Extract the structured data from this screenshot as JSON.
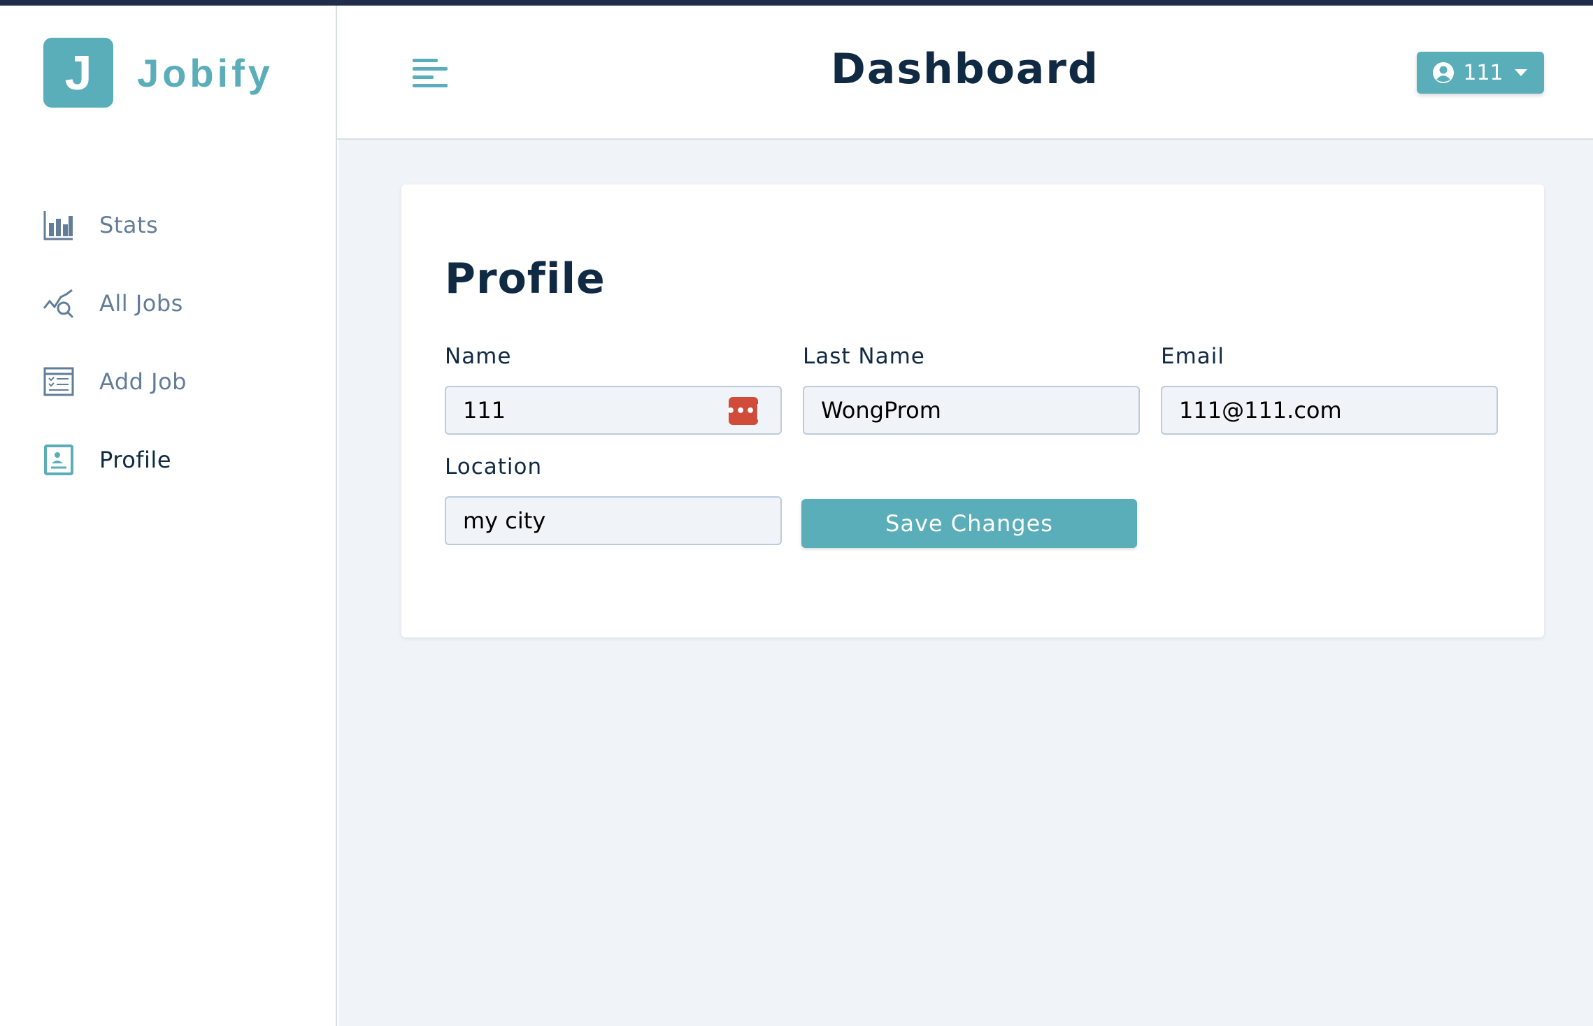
{
  "brand": {
    "logo_letter": "J",
    "name": "Jobify"
  },
  "sidebar": {
    "items": [
      {
        "label": "Stats",
        "icon": "bar-chart-icon"
      },
      {
        "label": "All Jobs",
        "icon": "chart-search-icon"
      },
      {
        "label": "Add Job",
        "icon": "form-icon"
      },
      {
        "label": "Profile",
        "icon": "id-badge-icon",
        "active": true
      }
    ]
  },
  "header": {
    "title": "Dashboard",
    "user_name": "111"
  },
  "profile": {
    "title": "Profile",
    "name_label": "Name",
    "name_value": "111",
    "last_name_label": "Last Name",
    "last_name_value": "WongProm",
    "email_label": "Email",
    "email_value": "111@111.com",
    "location_label": "Location",
    "location_value": "my city",
    "save_label": "Save Changes",
    "password_manager_badge": "•••|"
  },
  "colors": {
    "accent": "#5aaeb9",
    "background": "#f0f4f8",
    "topline": "#1f2d4a",
    "badge": "#d14b3a"
  }
}
